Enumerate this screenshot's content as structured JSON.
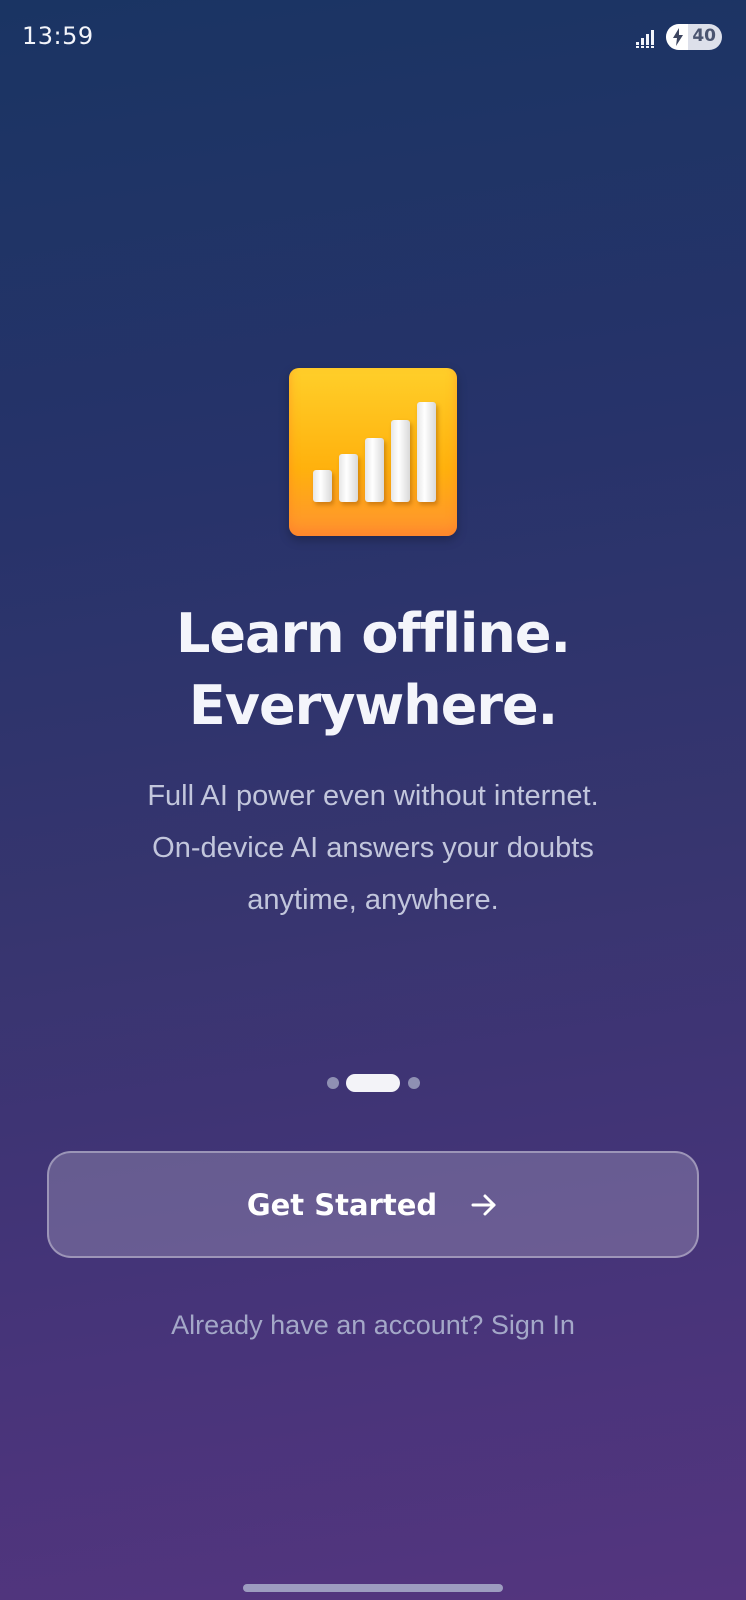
{
  "status_bar": {
    "time": "13:59",
    "battery_level": "40",
    "battery_fraction": 0.4
  },
  "hero": {
    "icon": "bar-chart-emoji-icon",
    "headline_line1": "Learn offline.",
    "headline_line2": "Everywhere.",
    "subtitle_lines": [
      "Full AI power even without internet.",
      "On-device AI answers your doubts",
      "anytime, anywhere."
    ]
  },
  "pager": {
    "total": 3,
    "active_index": 1
  },
  "actions": {
    "get_started_label": "Get Started",
    "get_started_icon": "arrow-right-icon",
    "signin_text": "Already have an account? Sign In"
  },
  "colors": {
    "background_top": "#1a3463",
    "background_bottom": "#54357f",
    "icon_yellow": "#ffc21a",
    "icon_orange": "#ff9330"
  }
}
